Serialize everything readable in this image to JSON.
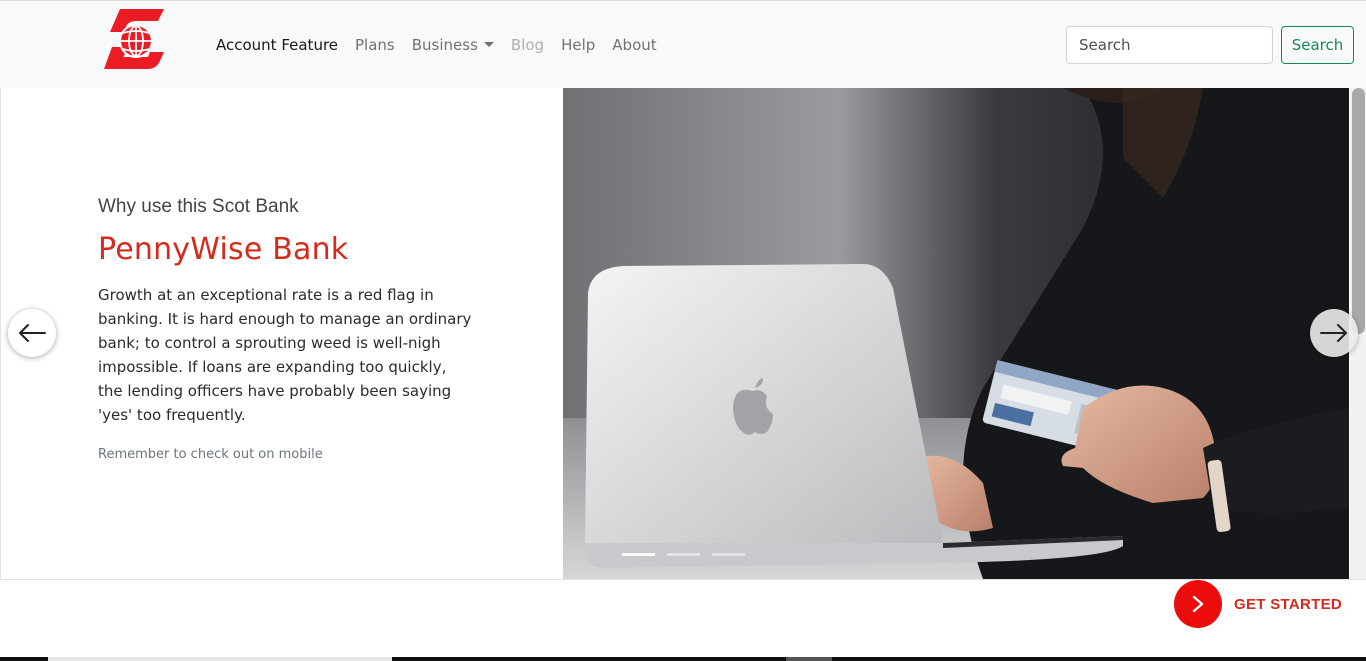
{
  "brand": {
    "logo_icon": "scotiabank-globe-logo-icon",
    "accent_color": "#ec0c0c"
  },
  "nav": {
    "items": [
      {
        "label": "Account Feature",
        "state": "active"
      },
      {
        "label": "Plans",
        "state": "normal"
      },
      {
        "label": "Business",
        "state": "dropdown"
      },
      {
        "label": "Blog",
        "state": "disabled"
      },
      {
        "label": "Help",
        "state": "normal"
      },
      {
        "label": "About",
        "state": "normal"
      }
    ],
    "search_placeholder": "Search",
    "search_button": "Search"
  },
  "hero": {
    "kicker": "Why use this Scot Bank",
    "title": "PennyWise Bank",
    "body": "Growth at an exceptional rate is a red flag in banking. It is hard enough to manage an ordinary bank; to control a sprouting weed is well-nigh impossible. If loans are expanding too quickly, the lending officers have probably been saying 'yes' too frequently.",
    "note": "Remember to check out on mobile",
    "title_color": "#d52b1e"
  },
  "carousel": {
    "slides": 3,
    "active_slide": 1
  },
  "cta": {
    "label": "GET STARTED"
  }
}
